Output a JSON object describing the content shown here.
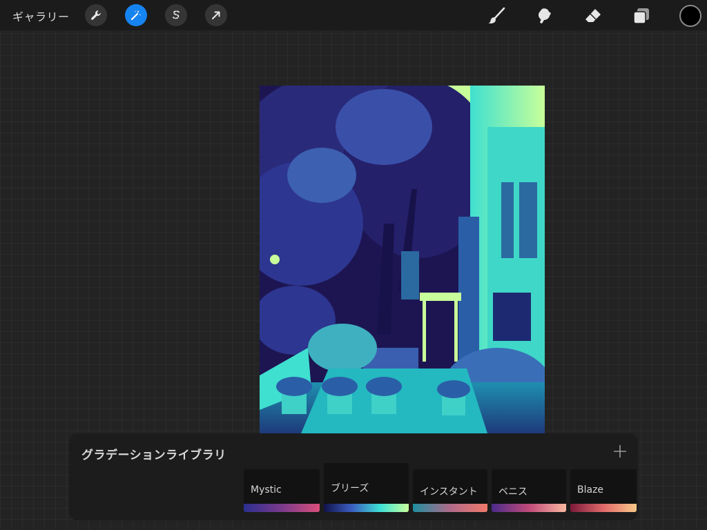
{
  "topbar": {
    "gallery_label": "ギャラリー",
    "left_tools": [
      {
        "name": "actions",
        "icon": "wrench-icon",
        "active": false
      },
      {
        "name": "adjustments",
        "icon": "magic-wand-icon",
        "active": true
      },
      {
        "name": "selection",
        "icon": "selection-s-icon",
        "active": false
      },
      {
        "name": "transform",
        "icon": "arrow-cursor-icon",
        "active": false
      }
    ],
    "right_tools": [
      {
        "name": "brush",
        "icon": "brush-icon"
      },
      {
        "name": "smudge",
        "icon": "smudge-icon"
      },
      {
        "name": "eraser",
        "icon": "eraser-icon"
      },
      {
        "name": "layers",
        "icon": "layers-icon"
      }
    ],
    "current_color": "#000000",
    "active_color": "#1583f0"
  },
  "panel": {
    "title": "グラデーションライブラリ",
    "add_icon": "plus-icon",
    "gradients": [
      {
        "name": "Mystic",
        "stops": [
          "#2b2f8f",
          "#7a3a8c",
          "#d94f7a"
        ],
        "selected": false
      },
      {
        "name": "ブリーズ",
        "stops": [
          "#12124a",
          "#3a5fc0",
          "#3fe0d6",
          "#c8ff9a"
        ],
        "selected": true
      },
      {
        "name": "インスタント",
        "stops": [
          "#1f8fa0",
          "#b06a8a",
          "#f07a6a"
        ],
        "selected": false
      },
      {
        "name": "ベニス",
        "stops": [
          "#4a2a8a",
          "#c04a7a",
          "#f8b8a0"
        ],
        "selected": false
      },
      {
        "name": "Blaze",
        "stops": [
          "#7a1a3a",
          "#e06a6a",
          "#f8c888"
        ],
        "selected": false
      }
    ]
  },
  "canvas": {
    "palette": [
      "#1d1552",
      "#2a1f6e",
      "#1f5f9f",
      "#24b8c0",
      "#3fe0d0",
      "#c8ff9a"
    ]
  }
}
